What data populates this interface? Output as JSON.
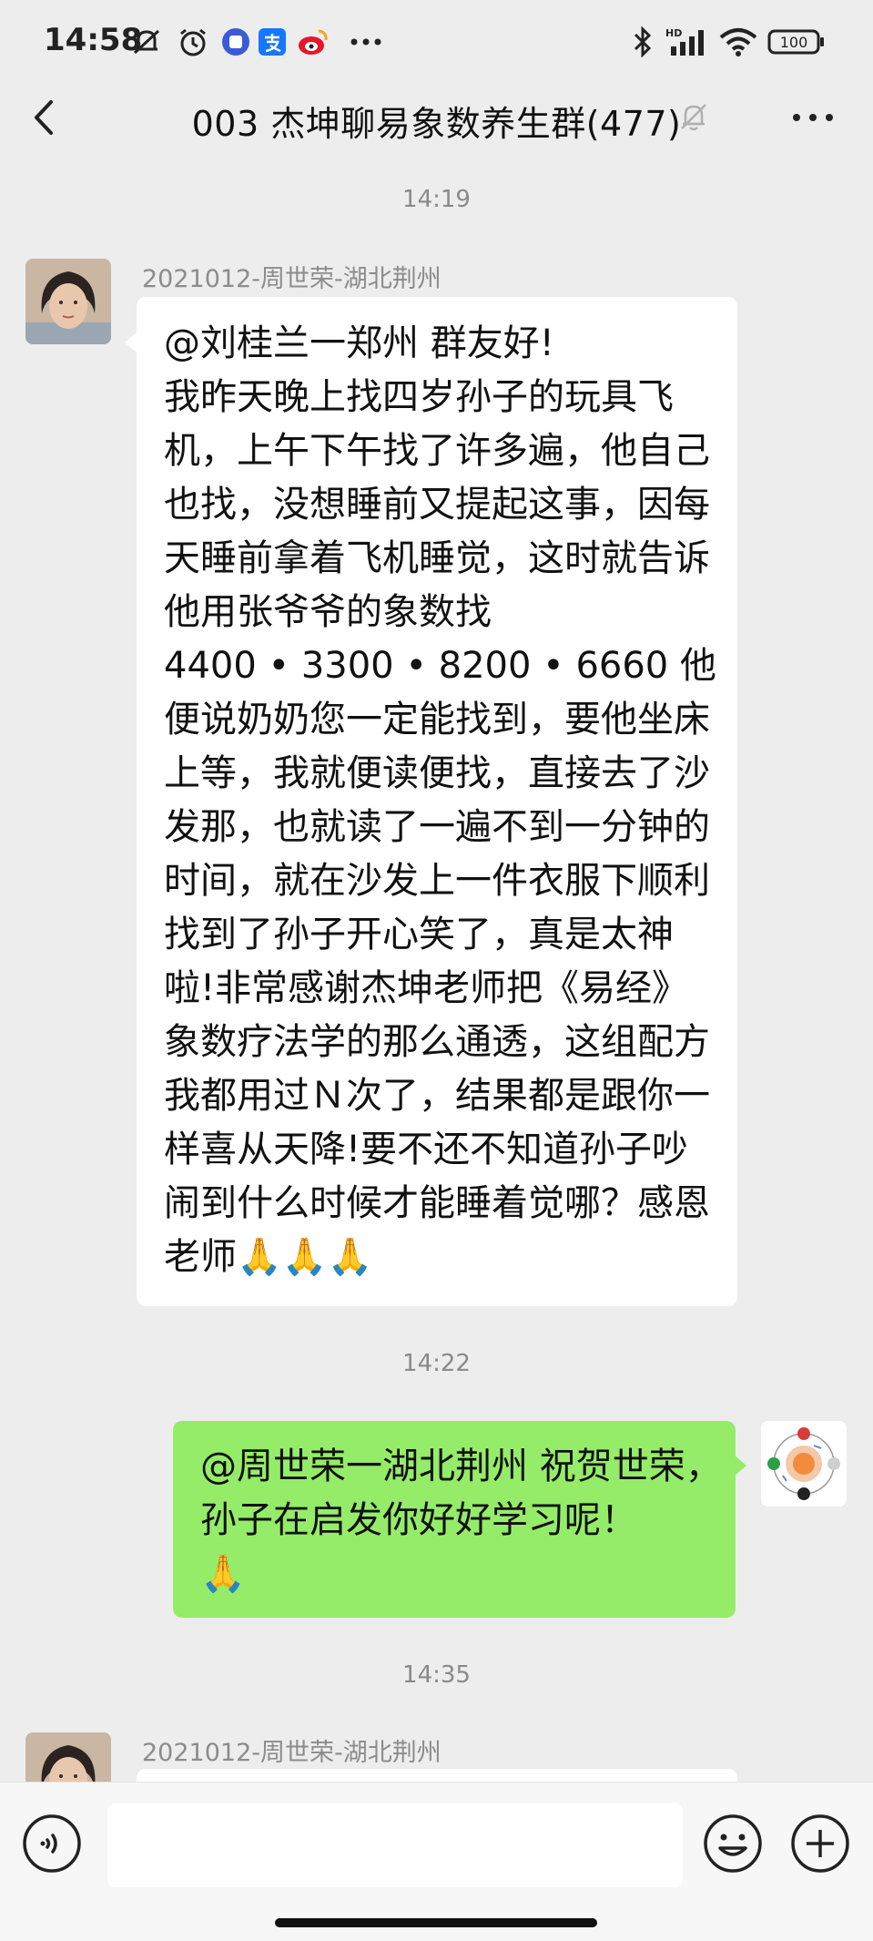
{
  "status_bar": {
    "time": "14:58",
    "icons": [
      "mute-notification-icon",
      "alarm-icon",
      "tieba-app-icon",
      "alipay-app-icon",
      "weibo-app-icon",
      "more-dots-icon",
      "bluetooth-icon",
      "hd-signal-icon",
      "wifi-icon",
      "battery-icon"
    ],
    "battery": "100"
  },
  "header": {
    "title": "003 杰坤聊易象数养生群(477)",
    "icons": [
      "back-icon",
      "mute-bell-icon",
      "more-icon"
    ]
  },
  "messages": [
    {
      "timestamp": "14:19",
      "sender": "2021012-周世荣-湖北荆州",
      "direction": "incoming",
      "lines": [
        "@刘桂兰一郑州  群友好!",
        "我昨天晚上找四岁孙子的玩具飞",
        "机，上午下午找了许多遍，他自己",
        "也找，没想睡前又提起这事，因每",
        "天睡前拿着飞机睡觉，这时就告诉",
        "他用张爷爷的象数找",
        "4400 • 3300 • 8200 • 6660  他",
        "便说奶奶您一定能找到，要他坐床",
        "上等，我就便读便找，直接去了沙",
        "发那，也就读了一遍不到一分钟的",
        "时间，就在沙发上一件衣服下顺利",
        "找到了孙子开心笑了，真是太神",
        "啦!非常感谢杰坤老师把《易经》",
        "象数疗法学的那么通透，这组配方",
        "我都用过Ｎ次了，结果都是跟你一",
        "样喜从天降!要不还不知道孙子吵",
        "闹到什么时候才能睡着觉哪？感恩",
        "老师"
      ],
      "emoji": "🙏🙏🙏"
    },
    {
      "timestamp": "14:22",
      "direction": "outgoing",
      "lines": [
        "@周世荣一湖北荆州  祝贺世荣，",
        "孙子在启发你好好学习呢！"
      ],
      "emoji": "🙏"
    },
    {
      "timestamp": "14:35",
      "sender": "2021012-周世荣-湖北荆州",
      "direction": "incoming"
    }
  ],
  "input_bar": {
    "placeholder": "",
    "icons": [
      "voice-icon",
      "emoji-icon",
      "plus-icon"
    ]
  },
  "colors": {
    "background": "#ededed",
    "outgoing_bubble": "#95ec69",
    "incoming_bubble": "#ffffff"
  }
}
